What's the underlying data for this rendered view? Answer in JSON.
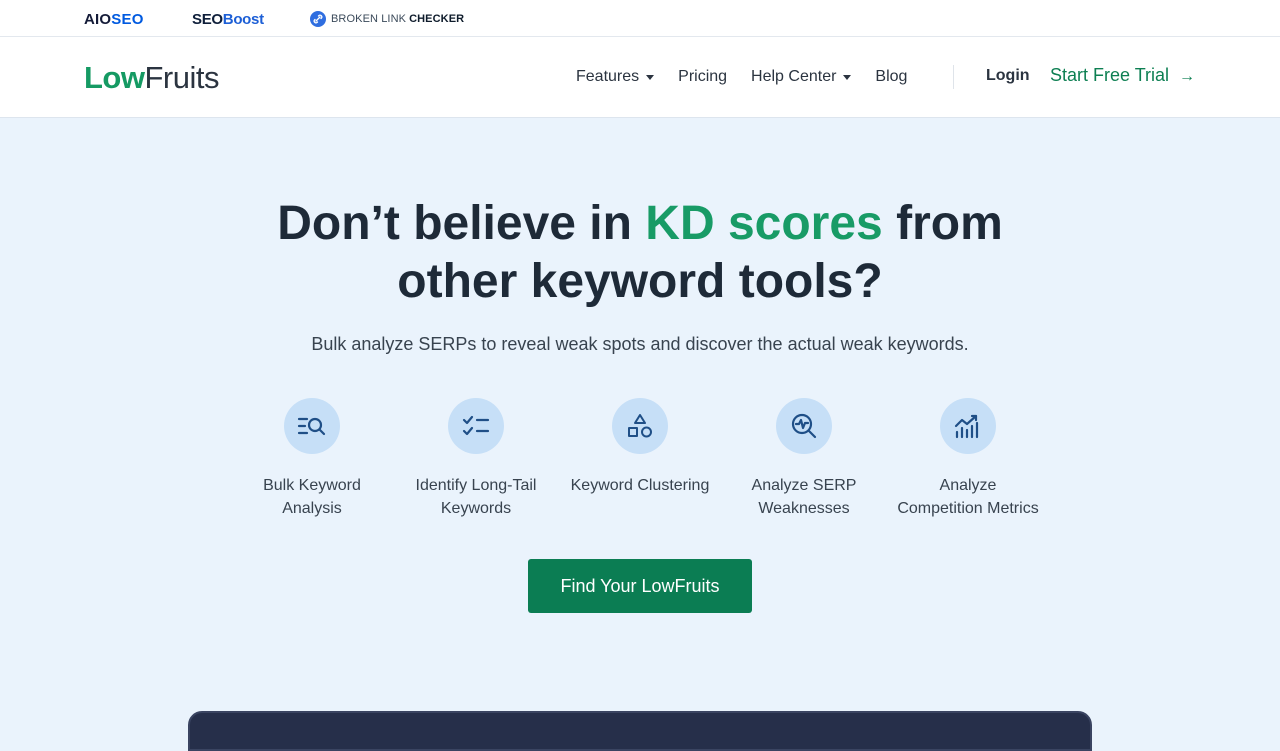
{
  "brandbar": {
    "aioseo": {
      "part1": "AIO",
      "part2": "SEO"
    },
    "seoboost": {
      "part1": "SEO",
      "part2": "Boost"
    },
    "blc": {
      "part1": "BROKEN LINK",
      "part2": "CHECKER"
    }
  },
  "header": {
    "logo": {
      "part1": "Low",
      "part2": "Fruits"
    },
    "nav": [
      {
        "label": "Features",
        "dropdown": true
      },
      {
        "label": "Pricing",
        "dropdown": false
      },
      {
        "label": "Help Center",
        "dropdown": true
      },
      {
        "label": "Blog",
        "dropdown": false
      }
    ],
    "login": "Login",
    "trial": "Start Free Trial",
    "trial_arrow": "→"
  },
  "hero": {
    "title_part1": "Don’t believe in ",
    "title_accent": "KD scores",
    "title_part2": " from",
    "title_line2": "other keyword tools?",
    "subtitle": "Bulk analyze SERPs to reveal weak spots and discover the actual weak keywords.",
    "features": [
      {
        "icon": "bulk-search-icon",
        "line1": "Bulk Keyword",
        "line2": "Analysis"
      },
      {
        "icon": "checklist-icon",
        "line1": "Identify Long-Tail",
        "line2": "Keywords"
      },
      {
        "icon": "shapes-icon",
        "line1": "Keyword Clustering",
        "line2": ""
      },
      {
        "icon": "serp-analysis-icon",
        "line1": "Analyze SERP",
        "line2": "Weaknesses"
      },
      {
        "icon": "chart-metrics-icon",
        "line1": "Analyze",
        "line2": "Competition Metrics"
      }
    ],
    "cta": "Find Your LowFruits"
  },
  "colors": {
    "accent_green": "#189b66",
    "cta_green": "#0b7d53",
    "hero_bg": "#eaf3fc",
    "icon_circle": "#c6dff7",
    "icon_stroke": "#1f4f87"
  }
}
